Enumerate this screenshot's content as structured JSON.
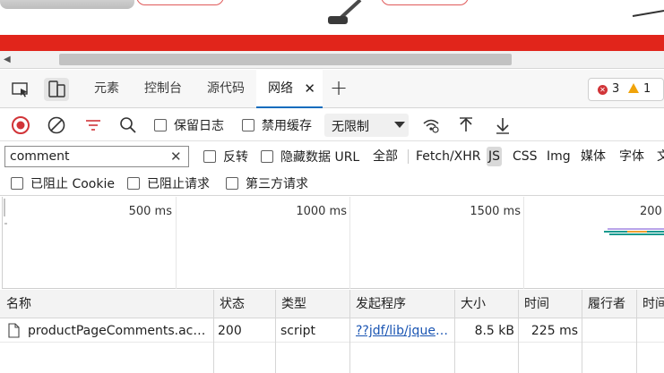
{
  "devtools": {
    "tabs": [
      {
        "label": "元素"
      },
      {
        "label": "控制台"
      },
      {
        "label": "源代码"
      },
      {
        "label": "网络",
        "active": true
      }
    ],
    "errors_count": "3",
    "warnings_count": "1"
  },
  "toolbar": {
    "preserve_log": "保留日志",
    "disable_cache": "禁用缓存",
    "throttle": "无限制"
  },
  "filter": {
    "value": "comment",
    "invert": "反转",
    "hide_data_urls": "隐藏数据 URL",
    "types": [
      "全部",
      "Fetch/XHR",
      "JS",
      "CSS",
      "Img",
      "媒体",
      "字体",
      "文"
    ],
    "selected_type": "JS",
    "blocked_cookies": "已阻止 Cookie",
    "blocked_requests": "已阻止请求",
    "third_party": "第三方请求"
  },
  "overview": {
    "ticks": [
      "500 ms",
      "1000 ms",
      "1500 ms",
      "200"
    ]
  },
  "table": {
    "columns": [
      "名称",
      "状态",
      "类型",
      "发起程序",
      "大小",
      "时间",
      "履行者",
      "时间"
    ],
    "rows": [
      {
        "name": "productPageComments.acti...",
        "status": "200",
        "type": "script",
        "initiator": "??jdf/lib/jquer...",
        "size": "8.5 kB",
        "time": "225 ms",
        "fulfilled_by": "",
        "waterfall": ""
      }
    ]
  },
  "colors": {
    "accent": "#0f6cbd",
    "record_red": "#d13438",
    "page_banner": "#e1251b"
  }
}
